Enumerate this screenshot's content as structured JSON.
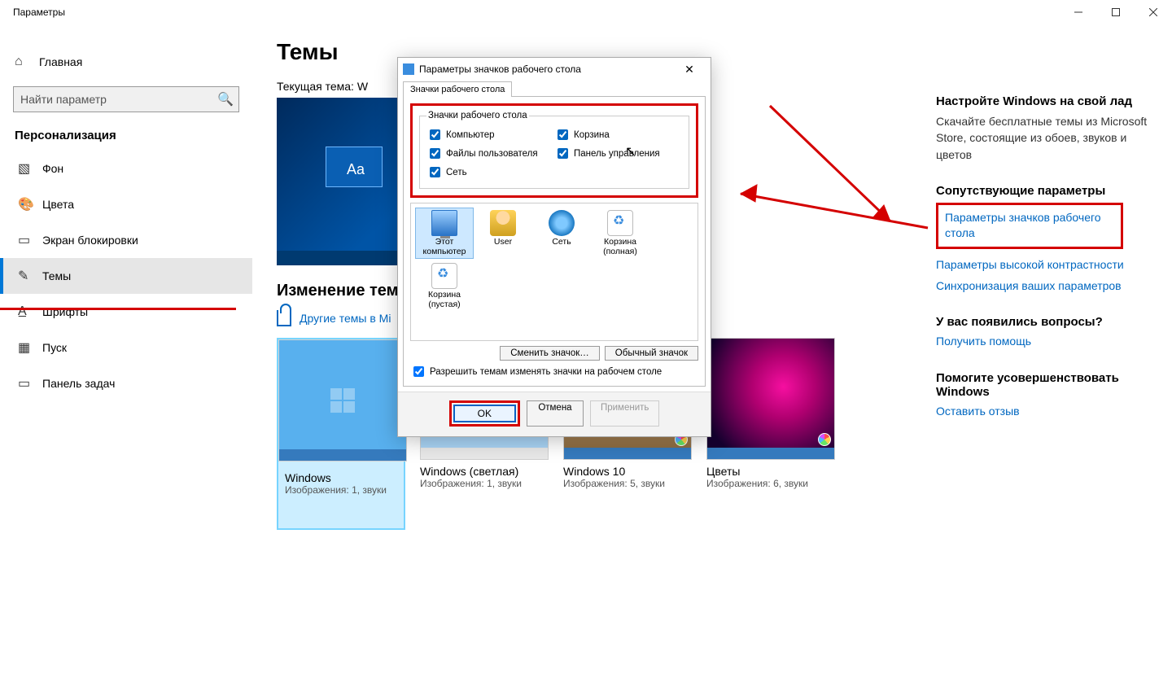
{
  "window": {
    "title": "Параметры"
  },
  "sidebar": {
    "home": "Главная",
    "search_placeholder": "Найти параметр",
    "section": "Персонализация",
    "items": [
      {
        "icon": "image-icon",
        "label": "Фон"
      },
      {
        "icon": "palette-icon",
        "label": "Цвета"
      },
      {
        "icon": "lock-screen-icon",
        "label": "Экран блокировки"
      },
      {
        "icon": "themes-icon",
        "label": "Темы"
      },
      {
        "icon": "font-icon",
        "label": "Шрифты"
      },
      {
        "icon": "start-icon",
        "label": "Пуск"
      },
      {
        "icon": "taskbar-icon",
        "label": "Панель задач"
      }
    ],
    "active_index": 3
  },
  "main": {
    "title": "Темы",
    "current_theme_label": "Текущая тема: W",
    "preview_aa": "Aa",
    "change_theme_heading": "Изменение темы",
    "store_link": "Другие темы в Mi",
    "themes": [
      {
        "name": "Windows",
        "meta": "Изображения: 1, звуки"
      },
      {
        "name": "Windows (светлая)",
        "meta": "Изображения: 1, звуки"
      },
      {
        "name": "Windows 10",
        "meta": "Изображения: 5, звуки"
      },
      {
        "name": "Цветы",
        "meta": "Изображения: 6, звуки"
      }
    ]
  },
  "right": {
    "h1": "Настройте Windows на свой лад",
    "p1": "Скачайте бесплатные темы из Microsoft Store, состоящие из обоев, звуков и цветов",
    "h2": "Сопутствующие параметры",
    "link1": "Параметры значков рабочего стола",
    "link2": "Параметры высокой контрастности",
    "link3": "Синхронизация ваших параметров",
    "h3": "У вас появились вопросы?",
    "link4": "Получить помощь",
    "h4": "Помогите усовершенствовать Windows",
    "link5": "Оставить отзыв"
  },
  "dialog": {
    "title": "Параметры значков рабочего стола",
    "tab": "Значки рабочего стола",
    "group_title": "Значки рабочего стола",
    "checks": {
      "computer": "Компьютер",
      "recycle": "Корзина",
      "userfiles": "Файлы пользователя",
      "cpl": "Панель управления",
      "network": "Сеть"
    },
    "icons": {
      "thispc": "Этот\nкомпьютер",
      "user": "User",
      "net": "Сеть",
      "bin_full": "Корзина\n(полная)",
      "bin_empty": "Корзина\n(пустая)"
    },
    "btn_change": "Сменить значок…",
    "btn_default": "Обычный значок",
    "allow": "Разрешить темам изменять значки на рабочем столе",
    "ok": "OK",
    "cancel": "Отмена",
    "apply": "Применить"
  }
}
